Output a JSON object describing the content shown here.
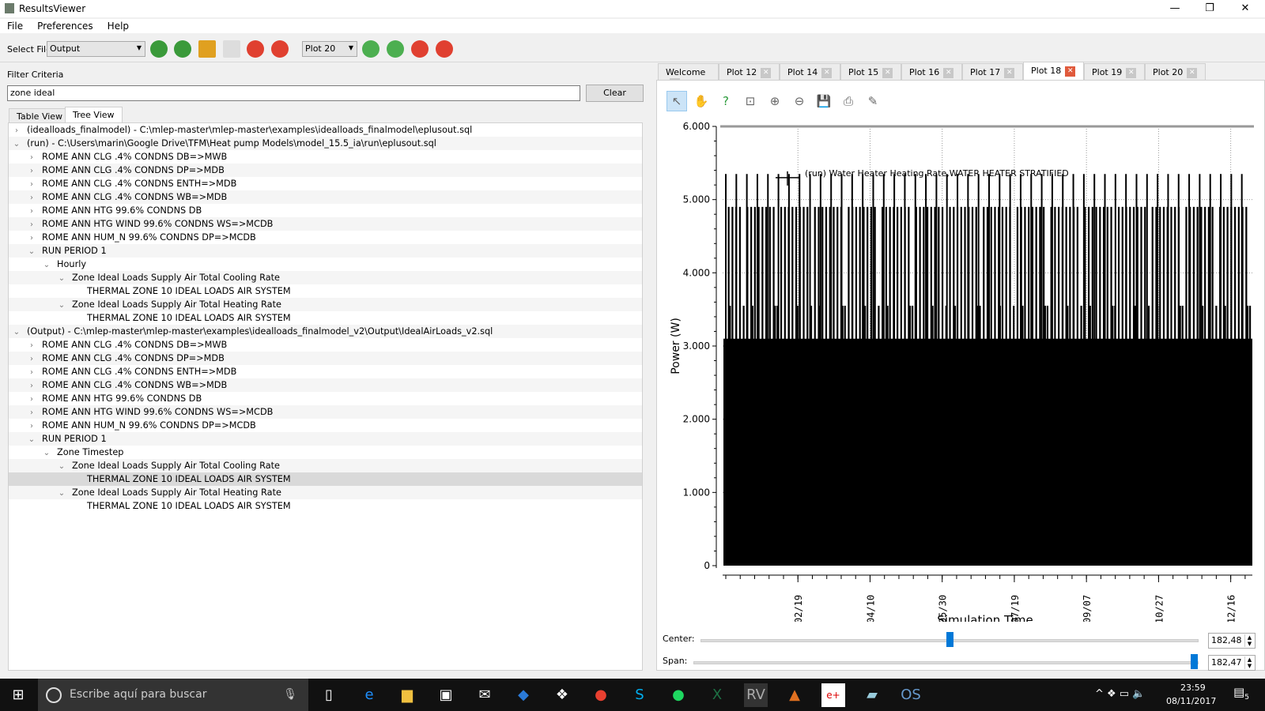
{
  "window": {
    "title": "ResultsViewer",
    "controls": [
      "—",
      "❐",
      "✕"
    ]
  },
  "menu": [
    "File",
    "Preferences",
    "Help"
  ],
  "toolbar": {
    "select_file_label": "Select File",
    "select_file_value": "Output",
    "plot_select_value": "Plot 20"
  },
  "filter": {
    "label": "Filter Criteria",
    "value": "zone ideal",
    "clear_label": "Clear"
  },
  "view_tabs": [
    {
      "label": "Table View",
      "active": false
    },
    {
      "label": "Tree View",
      "active": true
    }
  ],
  "tree": [
    {
      "level": 0,
      "exp": "closed",
      "text": "(idealloads_finalmodel) - C:\\mlep-master\\mlep-master\\examples\\idealloads_finalmodel\\eplusout.sql"
    },
    {
      "level": 0,
      "exp": "open",
      "text": "(run) - C:\\Users\\marin\\Google Drive\\TFM\\Heat pump Models\\model_15.5_ia\\run\\eplusout.sql"
    },
    {
      "level": 1,
      "exp": "closed",
      "text": "ROME ANN CLG .4% CONDNS DB=>MWB"
    },
    {
      "level": 1,
      "exp": "closed",
      "text": "ROME ANN CLG .4% CONDNS DP=>MDB"
    },
    {
      "level": 1,
      "exp": "closed",
      "text": "ROME ANN CLG .4% CONDNS ENTH=>MDB"
    },
    {
      "level": 1,
      "exp": "closed",
      "text": "ROME ANN CLG .4% CONDNS WB=>MDB"
    },
    {
      "level": 1,
      "exp": "closed",
      "text": "ROME ANN HTG 99.6% CONDNS DB"
    },
    {
      "level": 1,
      "exp": "closed",
      "text": "ROME ANN HTG WIND 99.6% CONDNS WS=>MCDB"
    },
    {
      "level": 1,
      "exp": "closed",
      "text": "ROME ANN HUM_N 99.6% CONDNS DP=>MCDB"
    },
    {
      "level": 1,
      "exp": "open",
      "text": "RUN PERIOD 1"
    },
    {
      "level": 2,
      "exp": "open",
      "text": "Hourly"
    },
    {
      "level": 3,
      "exp": "open",
      "text": "Zone Ideal Loads Supply Air Total Cooling Rate"
    },
    {
      "level": 4,
      "exp": "none",
      "text": "THERMAL ZONE 10 IDEAL LOADS AIR SYSTEM"
    },
    {
      "level": 3,
      "exp": "open",
      "text": "Zone Ideal Loads Supply Air Total Heating Rate"
    },
    {
      "level": 4,
      "exp": "none",
      "text": "THERMAL ZONE 10 IDEAL LOADS AIR SYSTEM"
    },
    {
      "level": 0,
      "exp": "open",
      "text": "(Output) - C:\\mlep-master\\mlep-master\\examples\\idealloads_finalmodel_v2\\Output\\IdealAirLoads_v2.sql"
    },
    {
      "level": 1,
      "exp": "closed",
      "text": "ROME ANN CLG .4% CONDNS DB=>MWB"
    },
    {
      "level": 1,
      "exp": "closed",
      "text": "ROME ANN CLG .4% CONDNS DP=>MDB"
    },
    {
      "level": 1,
      "exp": "closed",
      "text": "ROME ANN CLG .4% CONDNS ENTH=>MDB"
    },
    {
      "level": 1,
      "exp": "closed",
      "text": "ROME ANN CLG .4% CONDNS WB=>MDB"
    },
    {
      "level": 1,
      "exp": "closed",
      "text": "ROME ANN HTG 99.6% CONDNS DB"
    },
    {
      "level": 1,
      "exp": "closed",
      "text": "ROME ANN HTG WIND 99.6% CONDNS WS=>MCDB"
    },
    {
      "level": 1,
      "exp": "closed",
      "text": "ROME ANN HUM_N 99.6% CONDNS DP=>MCDB"
    },
    {
      "level": 1,
      "exp": "open",
      "text": "RUN PERIOD 1"
    },
    {
      "level": 2,
      "exp": "open",
      "text": "Zone Timestep"
    },
    {
      "level": 3,
      "exp": "open",
      "text": "Zone Ideal Loads Supply Air Total Cooling Rate"
    },
    {
      "level": 4,
      "exp": "none",
      "text": "THERMAL ZONE 10 IDEAL LOADS AIR SYSTEM",
      "selected": true
    },
    {
      "level": 3,
      "exp": "open",
      "text": "Zone Ideal Loads Supply Air Total Heating Rate"
    },
    {
      "level": 4,
      "exp": "none",
      "text": "THERMAL ZONE 10 IDEAL LOADS AIR SYSTEM"
    }
  ],
  "plot_tabs": [
    {
      "label": "Welcome",
      "active": false
    },
    {
      "label": "Plot 12",
      "active": false
    },
    {
      "label": "Plot 14",
      "active": false
    },
    {
      "label": "Plot 15",
      "active": false
    },
    {
      "label": "Plot 16",
      "active": false
    },
    {
      "label": "Plot 17",
      "active": false
    },
    {
      "label": "Plot 18",
      "active": true
    },
    {
      "label": "Plot 19",
      "active": false
    },
    {
      "label": "Plot 20",
      "active": false
    }
  ],
  "chart_tools": [
    "select-icon",
    "pan-icon",
    "whats-this-icon",
    "zoom-box-icon",
    "zoom-in-icon",
    "zoom-out-icon",
    "save-icon",
    "print-icon",
    "properties-icon"
  ],
  "chart_data": {
    "type": "line",
    "xlabel": "Simulation Time",
    "ylabel": "Power (W)",
    "ylim": [
      0,
      6000
    ],
    "yticks": [
      {
        "v": 0,
        "label": "0"
      },
      {
        "v": 1000,
        "label": "1.000"
      },
      {
        "v": 2000,
        "label": "2.000"
      },
      {
        "v": 3000,
        "label": "3.000"
      },
      {
        "v": 4000,
        "label": "4.000"
      },
      {
        "v": 5000,
        "label": "5.000"
      },
      {
        "v": 6000,
        "label": "6.000"
      }
    ],
    "xticks": [
      "02/19",
      "04/10",
      "05/30",
      "07/19",
      "09/07",
      "10/27",
      "12/16"
    ],
    "grid": true,
    "legend": {
      "position": "top-left",
      "entries": [
        "(run) Water Heater Heating Rate,WATER HEATER STRATIFIED"
      ]
    },
    "series": [
      {
        "name": "(run) Water Heater Heating Rate,WATER HEATER STRATIFIED",
        "color": "#000000",
        "levels_w": {
          "continuous_band_max": 3100,
          "frequent_peak": 3550,
          "common_peak": 4900,
          "max_peak": 5350
        }
      }
    ]
  },
  "center": {
    "label": "Center:",
    "value": "182,48",
    "fraction": 0.5
  },
  "span": {
    "label": "Span:",
    "value": "182,47",
    "fraction": 1.0
  },
  "taskbar": {
    "search_placeholder": "Escribe aquí para buscar",
    "time": "23:59",
    "date": "08/11/2017",
    "notifications": "5"
  }
}
